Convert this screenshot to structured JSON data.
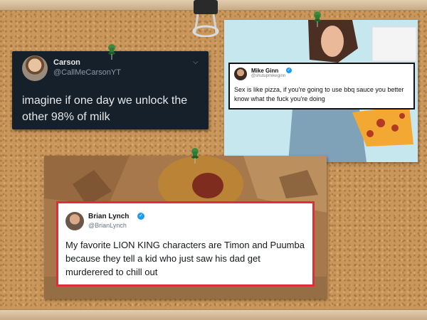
{
  "board": {
    "background": "#c9965b"
  },
  "tweet_carson": {
    "name": "Carson",
    "handle": "@CallMeCarsonYT",
    "text": "imagine if one day we unlock the other 98% of milk",
    "menu_icon": "chevron-down-icon",
    "bg_color": "#15202b"
  },
  "tweet_mike": {
    "name": "Mike Ginn",
    "handle": "@shutupmikeginn",
    "text": "Sex is like pizza, if you're going to use bbq sauce you better know what the fuck you're doing",
    "verified_icon": "verified-badge-icon"
  },
  "tweet_brian": {
    "name": "Brian Lynch",
    "handle": "@BrianLynch",
    "text": "My favorite LION KING characters are Timon and Puumba because they tell a kid who just saw his dad get murderered to chill out",
    "verified_icon": "verified-badge-icon",
    "border_color": "#e02d3c"
  }
}
